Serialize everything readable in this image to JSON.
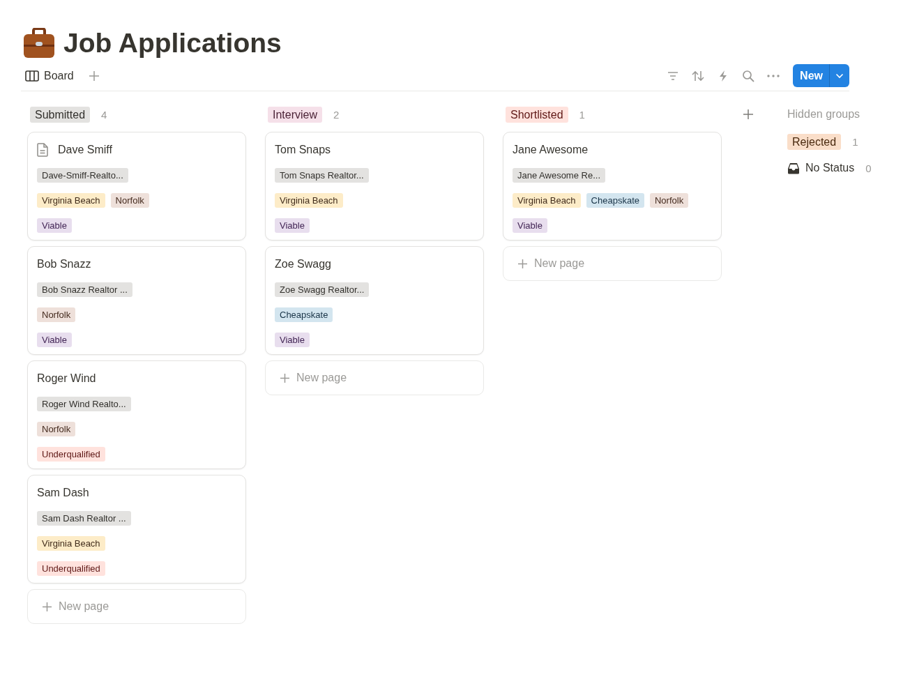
{
  "page": {
    "title": "Job Applications"
  },
  "view_tabs": [
    {
      "label": "Board",
      "selected": true
    }
  ],
  "toolbar": {
    "new_button": "New"
  },
  "groups": [
    {
      "label": "Submitted",
      "color": "#e3e2e0",
      "count": "4",
      "cards": [
        {
          "name": "Dave Smiff",
          "page_icon": true,
          "rows": [
            [
              {
                "label": "Dave-Smiff-Realto...",
                "color": "#e3e2e0"
              }
            ],
            [
              {
                "label": "Virginia Beach",
                "color": "#fdecc8"
              },
              {
                "label": "Norfolk",
                "color": "#eee0da"
              }
            ],
            [
              {
                "label": "Viable",
                "color": "#e8deee"
              }
            ]
          ]
        },
        {
          "name": "Bob Snazz",
          "page_icon": false,
          "rows": [
            [
              {
                "label": "Bob Snazz Realtor ...",
                "color": "#e3e2e0"
              }
            ],
            [
              {
                "label": "Norfolk",
                "color": "#eee0da"
              }
            ],
            [
              {
                "label": "Viable",
                "color": "#e8deee"
              }
            ]
          ]
        },
        {
          "name": "Roger Wind",
          "page_icon": false,
          "rows": [
            [
              {
                "label": "Roger Wind Realto...",
                "color": "#e3e2e0"
              }
            ],
            [
              {
                "label": "Norfolk",
                "color": "#eee0da"
              }
            ],
            [
              {
                "label": "Underqualified",
                "color": "#ffe2dd"
              }
            ]
          ]
        },
        {
          "name": "Sam Dash",
          "page_icon": false,
          "rows": [
            [
              {
                "label": "Sam Dash Realtor ...",
                "color": "#e3e2e0"
              }
            ],
            [
              {
                "label": "Virginia Beach",
                "color": "#fdecc8"
              }
            ],
            [
              {
                "label": "Underqualified",
                "color": "#ffe2dd"
              }
            ]
          ]
        }
      ],
      "new_page": "New page"
    },
    {
      "label": "Interview",
      "color": "#f5e0e9",
      "count": "2",
      "cards": [
        {
          "name": "Tom Snaps",
          "page_icon": false,
          "rows": [
            [
              {
                "label": "Tom Snaps Realtor...",
                "color": "#e3e2e0"
              }
            ],
            [
              {
                "label": "Virginia Beach",
                "color": "#fdecc8"
              }
            ],
            [
              {
                "label": "Viable",
                "color": "#e8deee"
              }
            ]
          ]
        },
        {
          "name": "Zoe Swagg",
          "page_icon": false,
          "rows": [
            [
              {
                "label": "Zoe Swagg Realtor...",
                "color": "#e3e2e0"
              }
            ],
            [
              {
                "label": "Cheapskate",
                "color": "#d3e5ef"
              }
            ],
            [
              {
                "label": "Viable",
                "color": "#e8deee"
              }
            ]
          ]
        }
      ],
      "new_page": "New page"
    },
    {
      "label": "Shortlisted",
      "color": "#ffe2dd",
      "count": "1",
      "cards": [
        {
          "name": "Jane Awesome",
          "page_icon": false,
          "rows": [
            [
              {
                "label": "Jane Awesome Re...",
                "color": "#e3e2e0"
              }
            ],
            [
              {
                "label": "Virginia Beach",
                "color": "#fdecc8"
              },
              {
                "label": "Cheapskate",
                "color": "#d3e5ef"
              },
              {
                "label": "Norfolk",
                "color": "#eee0da"
              }
            ],
            [
              {
                "label": "Viable",
                "color": "#e8deee"
              }
            ]
          ]
        }
      ],
      "new_page": "New page"
    }
  ],
  "hidden_groups": {
    "title": "Hidden groups",
    "items": [
      {
        "kind": "tag",
        "label": "Rejected",
        "color": "#fadec9",
        "count": "1"
      },
      {
        "kind": "no_status",
        "label": "No Status",
        "count": "0"
      }
    ]
  }
}
